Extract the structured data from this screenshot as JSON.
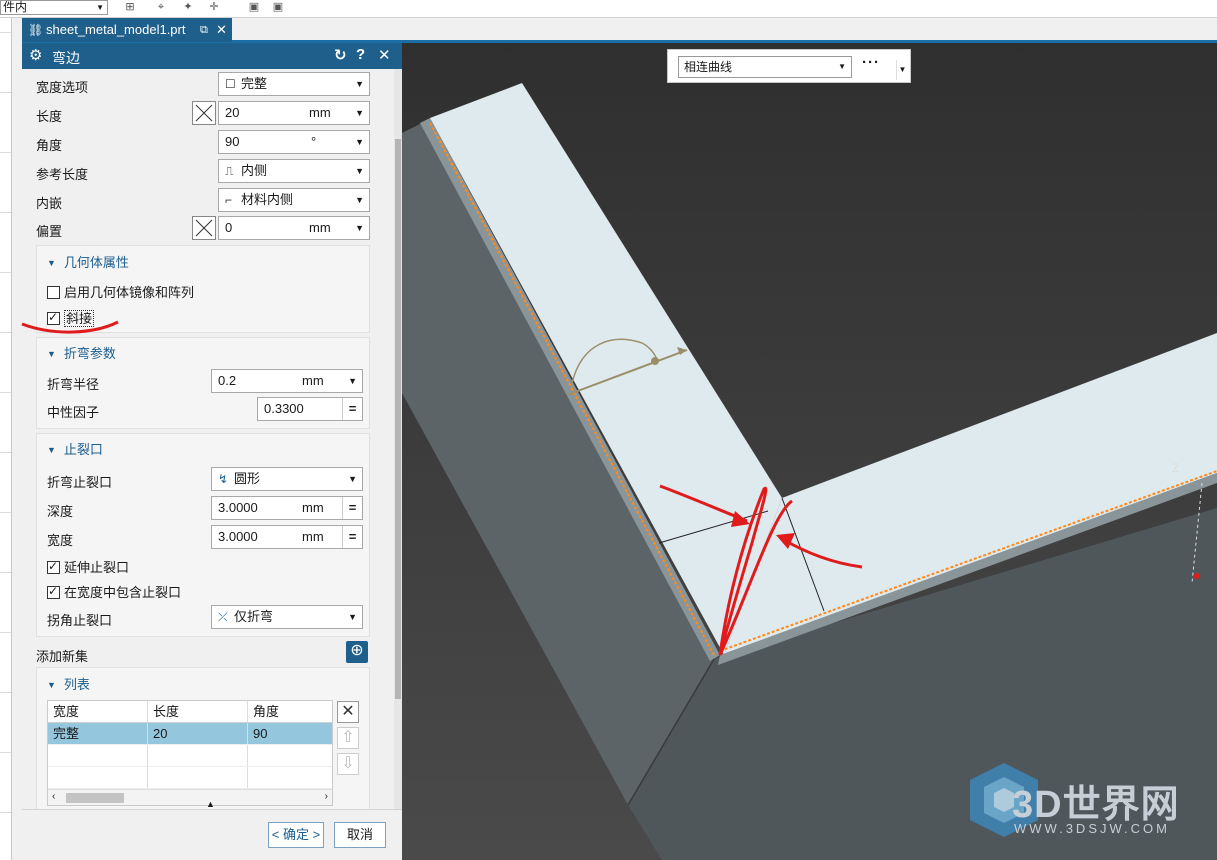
{
  "top": {
    "partial_select": "件内"
  },
  "tab": {
    "title": "sheet_metal_model1.prt"
  },
  "dialog": {
    "title": "弯边",
    "fields": {
      "width_option_label": "宽度选项",
      "width_option_value": "完整",
      "length_label": "长度",
      "length_value": "20",
      "length_unit": "mm",
      "angle_label": "角度",
      "angle_value": "90",
      "angle_unit": "°",
      "ref_length_label": "参考长度",
      "ref_length_value": "内侧",
      "inset_label": "内嵌",
      "inset_value": "材料内侧",
      "offset_label": "偏置",
      "offset_value": "0",
      "offset_unit": "mm"
    },
    "geometry_group": {
      "title": "几何体属性",
      "mirror_pattern_label": "启用几何体镜像和阵列",
      "mirror_pattern_checked": false,
      "miter_label": "斜接",
      "miter_checked": true
    },
    "bend_group": {
      "title": "折弯参数",
      "radius_label": "折弯半径",
      "radius_value": "0.2",
      "radius_unit": "mm",
      "kfactor_label": "中性因子",
      "kfactor_value": "0.3300",
      "kfactor_btn": "="
    },
    "relief_group": {
      "title": "止裂口",
      "bend_relief_label": "折弯止裂口",
      "bend_relief_value": "圆形",
      "depth_label": "深度",
      "depth_value": "3.0000",
      "depth_unit": "mm",
      "width_label": "宽度",
      "width_value": "3.0000",
      "width_unit": "mm",
      "extend_label": "延伸止裂口",
      "extend_checked": true,
      "include_label": "在宽度中包含止裂口",
      "include_checked": true,
      "corner_label": "拐角止裂口",
      "corner_value": "仅折弯"
    },
    "add_set_label": "添加新集",
    "list_group": {
      "title": "列表",
      "headers": [
        "宽度",
        "长度",
        "角度"
      ],
      "rows": [
        [
          "完整",
          "20",
          "90"
        ]
      ]
    },
    "ok_label": "< 确定 >",
    "cancel_label": "取消"
  },
  "viewport": {
    "selection_filter": "相连曲线",
    "more_label": "···",
    "axis_label": "Z"
  },
  "watermark": {
    "brand": "3D世界网",
    "url": "WWW.3DSJW.COM"
  },
  "colors": {
    "accent": "#1f5f8b",
    "selected_row": "#94c6dd",
    "annotation": "#e01b1b",
    "edge_highlight": "#ff8a1a"
  }
}
